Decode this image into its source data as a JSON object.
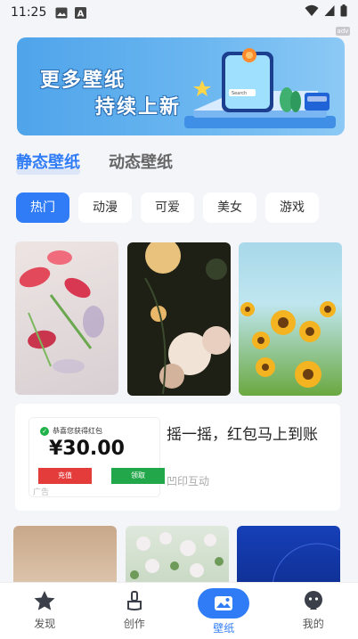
{
  "status_bar": {
    "time": "11:25",
    "icons": [
      "image-icon",
      "a-icon",
      "wifi-icon",
      "signal-icon",
      "battery-icon"
    ]
  },
  "banner": {
    "line1": "更多壁纸",
    "line2": "持续上新",
    "phone_search": "Search",
    "ad_tag": "adv"
  },
  "tabs": [
    {
      "label": "静态壁纸",
      "active": true
    },
    {
      "label": "动态壁纸",
      "active": false
    }
  ],
  "chips": [
    {
      "label": "热门",
      "active": true
    },
    {
      "label": "动漫",
      "active": false
    },
    {
      "label": "可爱",
      "active": false
    },
    {
      "label": "美女",
      "active": false
    },
    {
      "label": "游戏",
      "active": false
    }
  ],
  "ad": {
    "img_row1": "恭喜您获得红包",
    "amount": "¥30.00",
    "btn_left": "充值",
    "btn_right": "领取",
    "source": "广告",
    "title": "摇一摇，红包马上到账",
    "brand": "凹印互动"
  },
  "bottom_nav": [
    {
      "label": "发现",
      "icon": "star-icon",
      "active": false
    },
    {
      "label": "创作",
      "icon": "brush-icon",
      "active": false
    },
    {
      "label": "壁纸",
      "icon": "wallpaper-icon",
      "active": true
    },
    {
      "label": "我的",
      "icon": "profile-icon",
      "active": false
    }
  ],
  "colors": {
    "accent": "#2f7cf6",
    "background": "#f4f5f9"
  }
}
